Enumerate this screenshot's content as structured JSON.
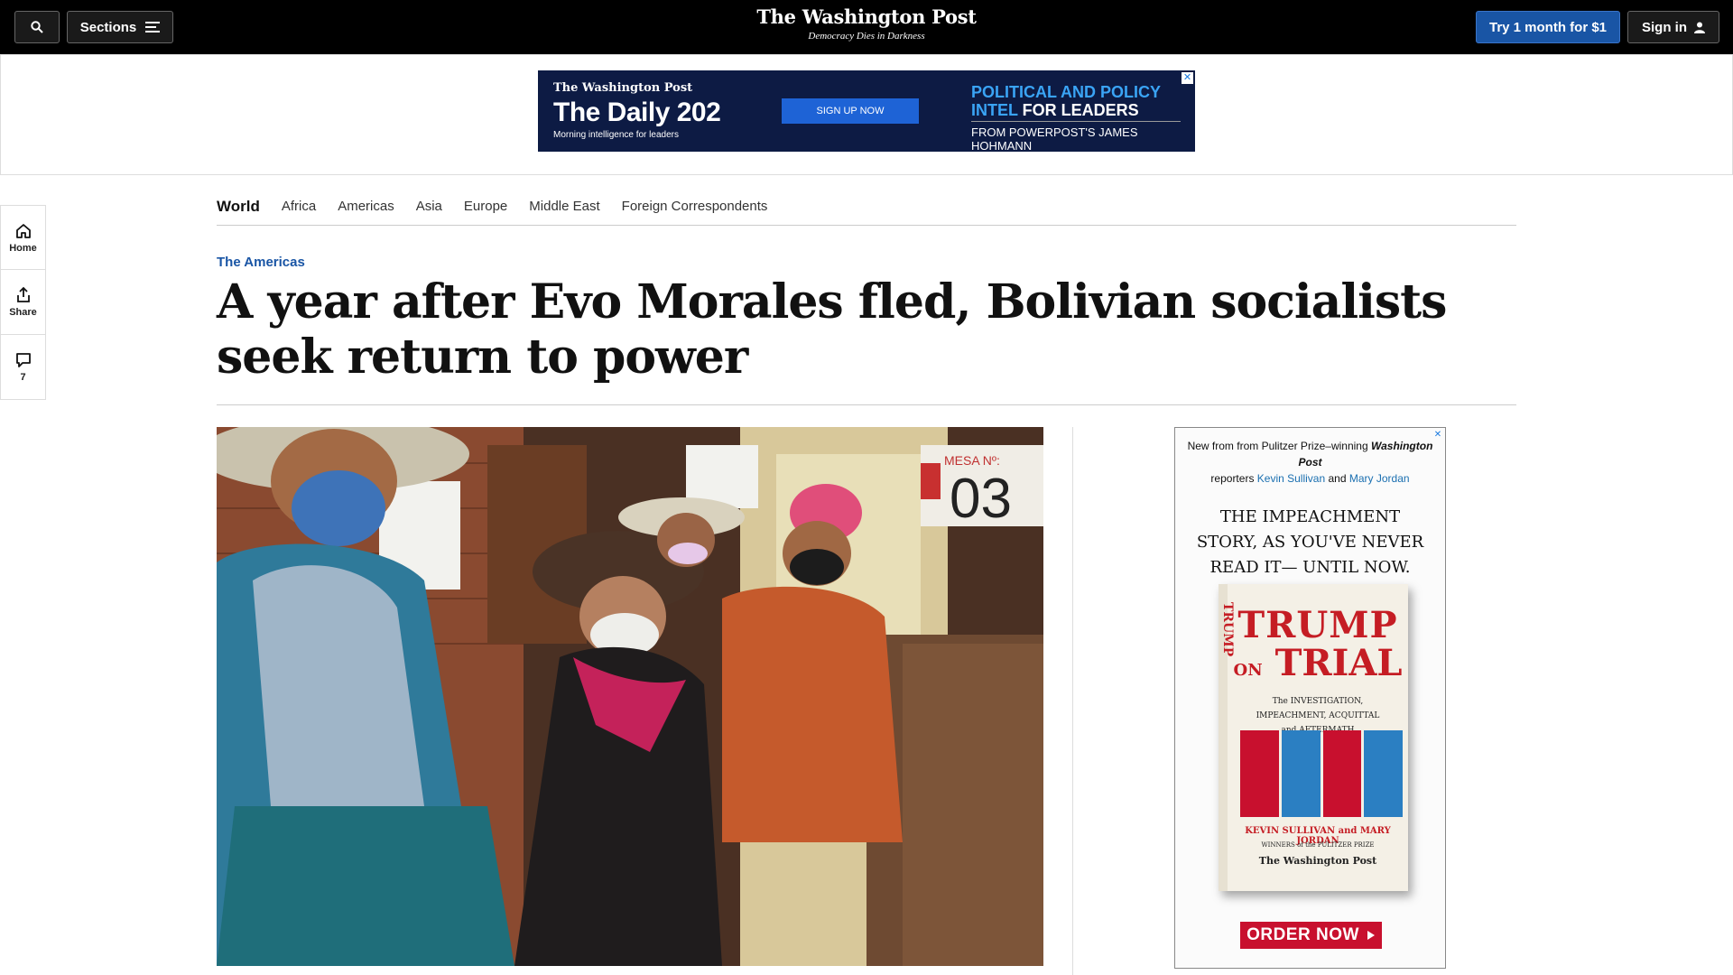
{
  "header": {
    "sections_label": "Sections",
    "logo_title": "The Washington Post",
    "logo_tagline": "Democracy Dies in Darkness",
    "try_label": "Try 1 month for $1",
    "sign_in_label": "Sign in"
  },
  "top_ad": {
    "logo": "The Washington Post",
    "title": "The Daily 202",
    "subtitle": "Morning intelligence for leaders",
    "button": "SIGN UP NOW",
    "right_line1_a": "POLITICAL AND POLICY",
    "right_line2_a": "INTEL",
    "right_line2_b": " FOR LEADERS",
    "right_footer": "FROM POWERPOST'S JAMES HOHMANN"
  },
  "subnav": {
    "items": [
      "World",
      "Africa",
      "Americas",
      "Asia",
      "Europe",
      "Middle East",
      "Foreign Correspondents"
    ]
  },
  "rail": {
    "home": "Home",
    "share": "Share",
    "comments_count": "7"
  },
  "article": {
    "kicker": "The Americas",
    "headline": "A year after Evo Morales fled, Bolivian socialists seek return to power",
    "photo_sign_label": "MESA Nº:",
    "photo_sign_number": "03"
  },
  "side_ad": {
    "line1_a": "New from from Pulitzer Prize–winning ",
    "line1_b": "Washington Post",
    "line2_a": "reporters ",
    "author1": "Kevin Sullivan",
    "line2_and": " and ",
    "author2": "Mary Jordan",
    "headline": "THE IMPEACHMENT STORY, AS YOU'VE NEVER READ IT— UNTIL NOW.",
    "book_t1": "TRUMP",
    "book_on": "ON",
    "book_t2": "TRIAL",
    "book_sub": "The INVESTIGATION, IMPEACHMENT, ACQUITTAL and AFTERMATH",
    "book_authors": "KEVIN SULLIVAN and MARY JORDAN",
    "book_winners": "WINNERS of the PULITZER PRIZE",
    "book_publisher": "The Washington Post",
    "book_spine": "TRUMP",
    "cta": "ORDER NOW"
  },
  "colors": {
    "topbar": "#000000",
    "accent_blue": "#1955a5",
    "ad_navy": "#0d1b44",
    "order_red": "#c8102e"
  }
}
